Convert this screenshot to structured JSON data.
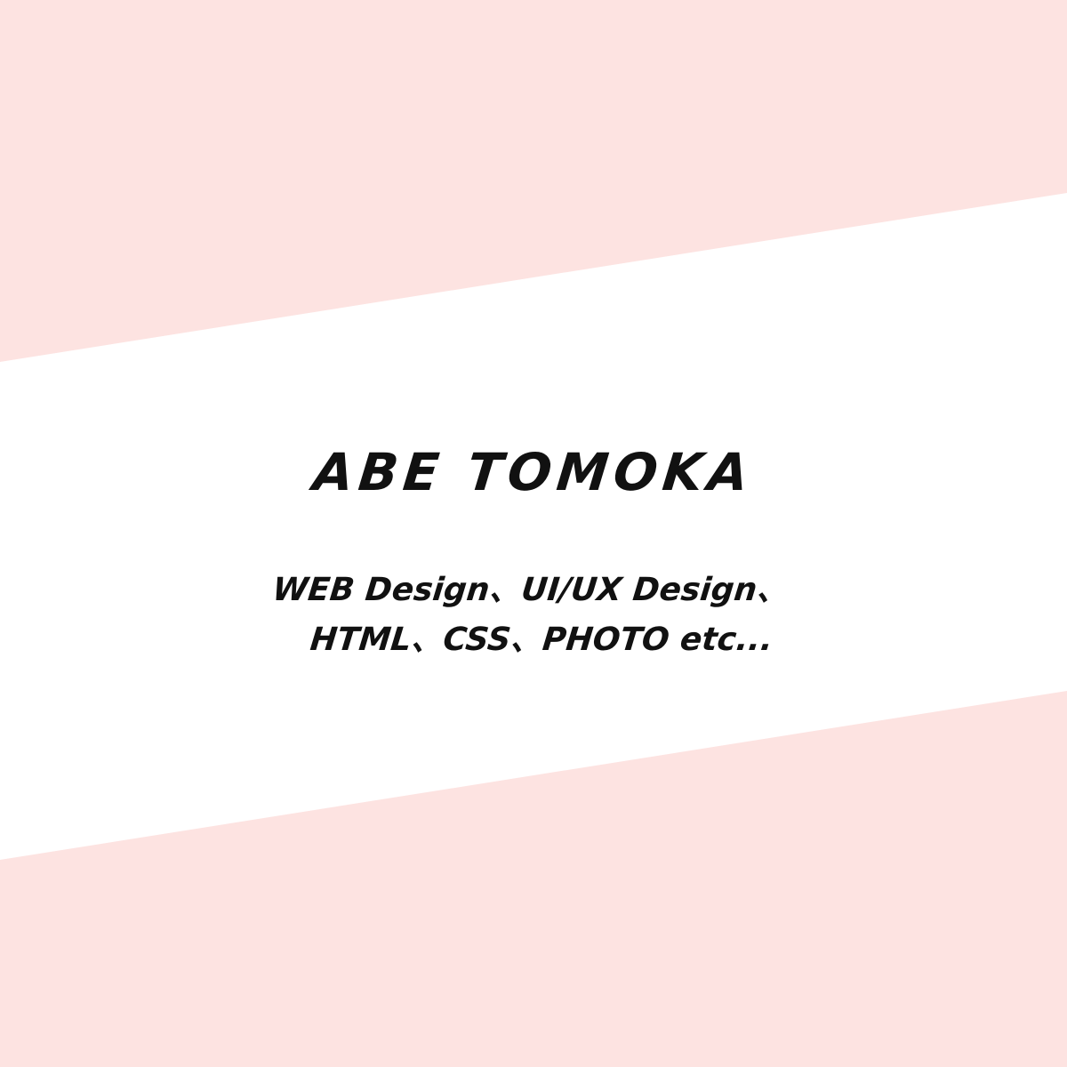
{
  "colors": {
    "stripe_pink": "#fde3e1",
    "band_white": "#ffffff",
    "text": "#111111"
  },
  "profile": {
    "name": "ABE TOMOKA",
    "skills_line_1": "WEB Design、UI/UX Design、",
    "skills_line_2": "HTML、CSS、PHOTO etc..."
  }
}
